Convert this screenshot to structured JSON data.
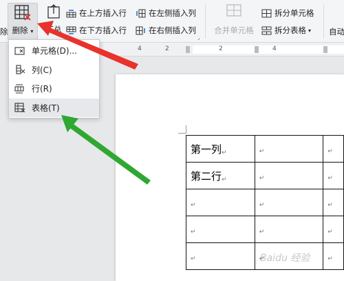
{
  "ribbon": {
    "left_cut_label": "除",
    "delete_label": "删除",
    "summary_label": "汇总",
    "insert_row_above": "在上方插入行",
    "insert_row_below": "在下方插入行",
    "insert_col_left": "在左侧插入列",
    "insert_col_right": "在右侧插入列",
    "merge_cells": "合并单元格",
    "split_cells": "拆分单元格",
    "split_table": "拆分表格",
    "auto_label": "自动"
  },
  "ruler": {
    "ticks": [
      "4",
      "2",
      "2",
      "4"
    ]
  },
  "delete_menu": {
    "items": [
      {
        "label": "单元格(D)...",
        "icon": "delete-cell-icon"
      },
      {
        "label": "列(C)",
        "icon": "delete-column-icon"
      },
      {
        "label": "行(R)",
        "icon": "delete-row-icon"
      },
      {
        "label": "表格(T)",
        "icon": "delete-table-icon",
        "highlighted": true
      }
    ]
  },
  "table": {
    "rows": [
      [
        "第一列",
        "",
        ""
      ],
      [
        "第二行",
        "",
        ""
      ],
      [
        "",
        "",
        ""
      ],
      [
        "",
        "",
        ""
      ],
      [
        "",
        "",
        ""
      ]
    ],
    "paragraph_mark": "↵"
  },
  "watermark": "Baidu 经验",
  "colors": {
    "red_arrow": "#e8322b",
    "green_arrow": "#2fa832",
    "accent": "#2d6fd6"
  }
}
